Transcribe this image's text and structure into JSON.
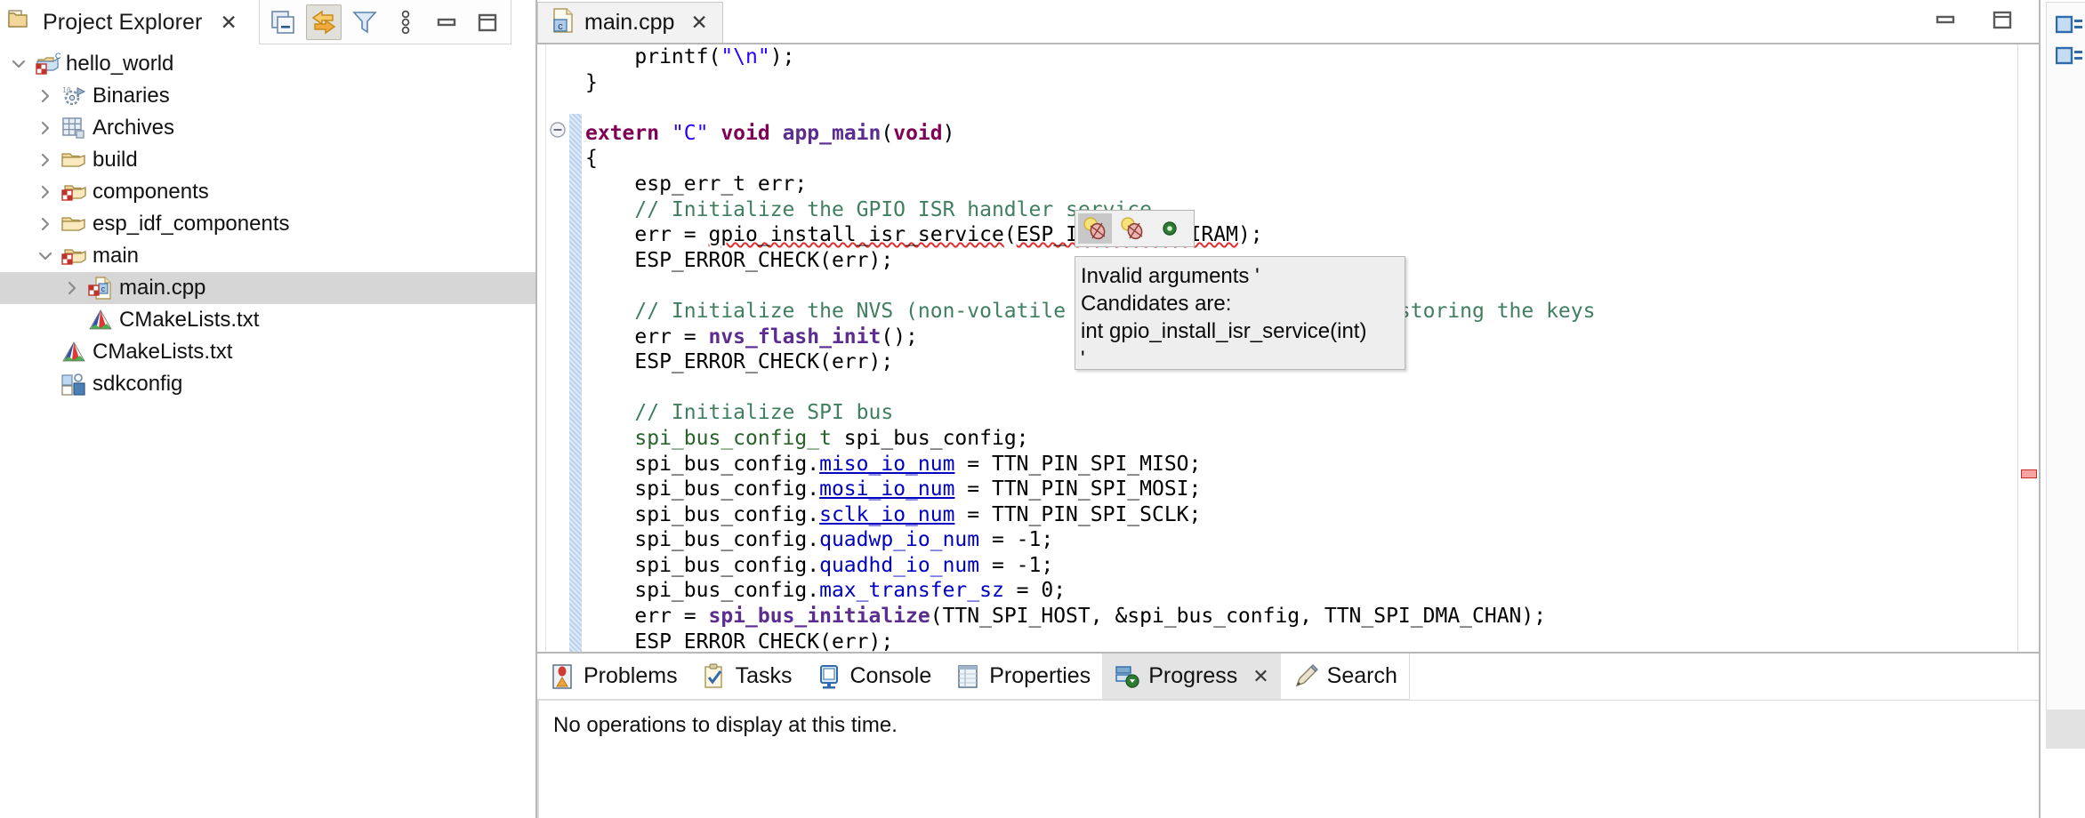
{
  "project_explorer": {
    "title": "Project Explorer",
    "close_label": "✕",
    "toolbar": [
      {
        "name": "collapse-all-icon",
        "tooltip": "Collapse All"
      },
      {
        "name": "link-with-editor-icon",
        "tooltip": "Link with Editor"
      },
      {
        "name": "filter-icon",
        "tooltip": "View Menu / Filters"
      },
      {
        "name": "view-menu-icon",
        "tooltip": "View Menu"
      },
      {
        "name": "minimize-icon",
        "tooltip": "Minimize"
      },
      {
        "name": "maximize-icon",
        "tooltip": "Maximize"
      }
    ],
    "tree": [
      {
        "label": "hello_world",
        "indent": 0,
        "twisty": "down",
        "icon": "c-project-icon",
        "selected": false
      },
      {
        "label": "Binaries",
        "indent": 1,
        "twisty": "right",
        "icon": "binaries-icon",
        "selected": false
      },
      {
        "label": "Archives",
        "indent": 1,
        "twisty": "right",
        "icon": "archives-icon",
        "selected": false
      },
      {
        "label": "build",
        "indent": 1,
        "twisty": "right",
        "icon": "folder-icon",
        "selected": false
      },
      {
        "label": "components",
        "indent": 1,
        "twisty": "right",
        "icon": "source-folder-icon",
        "selected": false
      },
      {
        "label": "esp_idf_components",
        "indent": 1,
        "twisty": "right",
        "icon": "folder-icon",
        "selected": false
      },
      {
        "label": "main",
        "indent": 1,
        "twisty": "down",
        "icon": "source-folder-icon",
        "selected": false
      },
      {
        "label": "main.cpp",
        "indent": 2,
        "twisty": "right",
        "icon": "cpp-file-icon",
        "selected": true
      },
      {
        "label": "CMakeLists.txt",
        "indent": 2,
        "twisty": "none",
        "icon": "cmake-file-icon",
        "selected": false
      },
      {
        "label": "CMakeLists.txt",
        "indent": 1,
        "twisty": "none",
        "icon": "cmake-file-icon",
        "selected": false
      },
      {
        "label": "sdkconfig",
        "indent": 1,
        "twisty": "none",
        "icon": "sdkconfig-icon",
        "selected": false
      }
    ]
  },
  "editor": {
    "tab_label": "main.cpp",
    "tab_close_label": "✕",
    "tab_icon": "cpp-file-icon",
    "window_buttons": [
      {
        "name": "minimize-icon",
        "tooltip": "Minimize"
      },
      {
        "name": "maximize-icon",
        "tooltip": "Maximize"
      }
    ],
    "code_lines": [
      {
        "indent": 0,
        "segments": [
          {
            "t": "    printf(",
            "c": "plain"
          },
          {
            "t": "\"\\n\"",
            "c": "str"
          },
          {
            "t": ");",
            "c": "plain"
          }
        ]
      },
      {
        "indent": 0,
        "segments": [
          {
            "t": "}",
            "c": "plain"
          }
        ]
      },
      {
        "indent": 0,
        "segments": [
          {
            "t": "",
            "c": "plain"
          }
        ]
      },
      {
        "indent": 0,
        "fold": true,
        "segments": [
          {
            "t": "extern ",
            "c": "kw"
          },
          {
            "t": "\"C\"",
            "c": "str"
          },
          {
            "t": " void",
            "c": "kw"
          },
          {
            "t": " ",
            "c": "plain"
          },
          {
            "t": "app_main",
            "c": "fn"
          },
          {
            "t": "(",
            "c": "plain"
          },
          {
            "t": "void",
            "c": "kw"
          },
          {
            "t": ")",
            "c": "plain"
          }
        ]
      },
      {
        "indent": 0,
        "segments": [
          {
            "t": "{",
            "c": "plain"
          }
        ]
      },
      {
        "indent": 0,
        "segments": [
          {
            "t": "    esp_err_t err;",
            "c": "plain"
          }
        ]
      },
      {
        "indent": 0,
        "segments": [
          {
            "t": "    // Initialize the GPIO ISR handler service",
            "c": "cmt"
          }
        ]
      },
      {
        "indent": 0,
        "segments": [
          {
            "t": "    err = ",
            "c": "plain"
          },
          {
            "t": "gpio_install_isr_service",
            "c": "err"
          },
          {
            "t": "(",
            "c": "plain"
          },
          {
            "t": "ESP_INTR_FLAG_IRAM",
            "c": "err"
          },
          {
            "t": ");",
            "c": "plain"
          }
        ]
      },
      {
        "indent": 0,
        "segments": [
          {
            "t": "    ESP_ERROR_CHECK(err);",
            "c": "plain"
          }
        ]
      },
      {
        "indent": 0,
        "segments": [
          {
            "t": "",
            "c": "plain"
          }
        ]
      },
      {
        "indent": 0,
        "segments": [
          {
            "t": "    // Initialize the NVS (non-volatile storage) for saving and restoring the keys",
            "c": "cmt"
          }
        ]
      },
      {
        "indent": 0,
        "segments": [
          {
            "t": "    err = ",
            "c": "plain"
          },
          {
            "t": "nvs_flash_init",
            "c": "fn"
          },
          {
            "t": "();",
            "c": "plain"
          }
        ]
      },
      {
        "indent": 0,
        "segments": [
          {
            "t": "    ESP_ERROR_CHECK(err);",
            "c": "plain"
          }
        ]
      },
      {
        "indent": 0,
        "segments": [
          {
            "t": "",
            "c": "plain"
          }
        ]
      },
      {
        "indent": 0,
        "segments": [
          {
            "t": "    // Initialize SPI bus",
            "c": "cmt"
          }
        ]
      },
      {
        "indent": 0,
        "segments": [
          {
            "t": "    ",
            "c": "plain"
          },
          {
            "t": "spi_bus_config_t",
            "c": "typ"
          },
          {
            "t": " spi_bus_config;",
            "c": "plain"
          }
        ]
      },
      {
        "indent": 0,
        "segments": [
          {
            "t": "    spi_bus_config.",
            "c": "plain"
          },
          {
            "t": "miso_io_num",
            "c": "fldu"
          },
          {
            "t": " = TTN_PIN_SPI_MISO;",
            "c": "plain"
          }
        ]
      },
      {
        "indent": 0,
        "segments": [
          {
            "t": "    spi_bus_config.",
            "c": "plain"
          },
          {
            "t": "mosi_io_num",
            "c": "fldu"
          },
          {
            "t": " = TTN_PIN_SPI_MOSI;",
            "c": "plain"
          }
        ]
      },
      {
        "indent": 0,
        "segments": [
          {
            "t": "    spi_bus_config.",
            "c": "plain"
          },
          {
            "t": "sclk_io_num",
            "c": "fldu"
          },
          {
            "t": " = TTN_PIN_SPI_SCLK;",
            "c": "plain"
          }
        ]
      },
      {
        "indent": 0,
        "segments": [
          {
            "t": "    spi_bus_config.",
            "c": "plain"
          },
          {
            "t": "quadwp_io_num",
            "c": "fld"
          },
          {
            "t": " = -1;",
            "c": "plain"
          }
        ]
      },
      {
        "indent": 0,
        "segments": [
          {
            "t": "    spi_bus_config.",
            "c": "plain"
          },
          {
            "t": "quadhd_io_num",
            "c": "fld"
          },
          {
            "t": " = -1;",
            "c": "plain"
          }
        ]
      },
      {
        "indent": 0,
        "segments": [
          {
            "t": "    spi_bus_config.",
            "c": "plain"
          },
          {
            "t": "max_transfer_sz",
            "c": "fld"
          },
          {
            "t": " = 0;",
            "c": "plain"
          }
        ]
      },
      {
        "indent": 0,
        "segments": [
          {
            "t": "    err = ",
            "c": "plain"
          },
          {
            "t": "spi_bus_initialize",
            "c": "fn"
          },
          {
            "t": "(TTN_SPI_HOST, &spi_bus_config, TTN_SPI_DMA_CHAN);",
            "c": "plain"
          }
        ]
      },
      {
        "indent": 0,
        "segments": [
          {
            "t": "    ESP_ERROR_CHECK(err);",
            "c": "plain"
          }
        ]
      }
    ],
    "overview_ruler": {
      "marker": "error-marker",
      "color": "#f5a3a3"
    }
  },
  "quickfix": {
    "buttons": [
      {
        "name": "quick-fix-bug-icon-selected",
        "selected": true
      },
      {
        "name": "quick-fix-bug-icon",
        "selected": false
      },
      {
        "name": "quick-fix-dot-icon",
        "selected": false
      }
    ]
  },
  "hover_tooltip": {
    "lines": [
      "Invalid arguments '",
      "Candidates are:",
      "int gpio_install_isr_service(int)",
      "'"
    ]
  },
  "bottom_panel": {
    "tabs": [
      {
        "label": "Problems",
        "icon": "problems-icon",
        "active": false,
        "closable": false
      },
      {
        "label": "Tasks",
        "icon": "tasks-icon",
        "active": false,
        "closable": false
      },
      {
        "label": "Console",
        "icon": "console-icon",
        "active": false,
        "closable": false
      },
      {
        "label": "Properties",
        "icon": "properties-icon",
        "active": false,
        "closable": false
      },
      {
        "label": "Progress",
        "icon": "progress-icon",
        "active": true,
        "closable": true
      },
      {
        "label": "Search",
        "icon": "search-icon",
        "active": false,
        "closable": false
      }
    ],
    "close_label": "✕",
    "message": "No operations to display at this time."
  },
  "right_strip": {
    "icons": [
      {
        "name": "outline-entry-icon"
      },
      {
        "name": "outline-entry-icon"
      }
    ]
  },
  "colors": {
    "selection": "#d6d6d6",
    "keyword": "#7f0055",
    "string": "#2a00ff",
    "comment": "#3f7f5f",
    "type": "#27632a",
    "field": "#0000c0",
    "function": "#5c2d91",
    "error": "#e03030",
    "active_tab": "#e4e4e4"
  }
}
